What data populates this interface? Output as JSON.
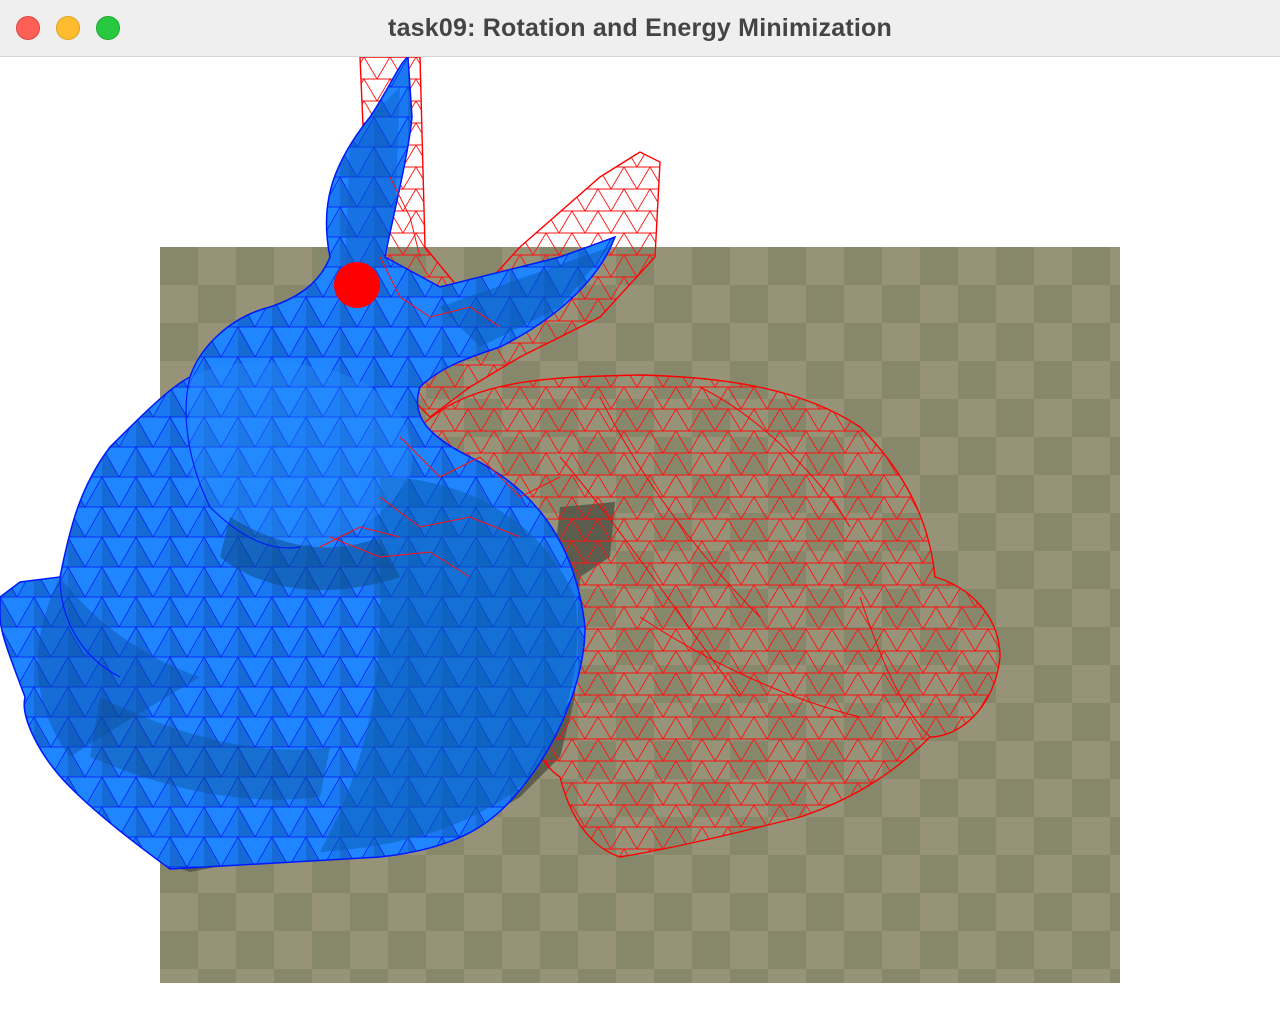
{
  "window": {
    "title": "task09: Rotation and Energy Minimization"
  },
  "colors": {
    "floor_light": "#969378",
    "floor_dark": "#87876c",
    "deformed_mesh": "#1f7cff",
    "deformed_mesh_edge": "#0000ff",
    "rest_wire": "#ff0000",
    "handle": "#ff0000"
  },
  "icons": {
    "close": "close-button",
    "minimize": "minimize-button",
    "zoom": "zoom-button"
  }
}
